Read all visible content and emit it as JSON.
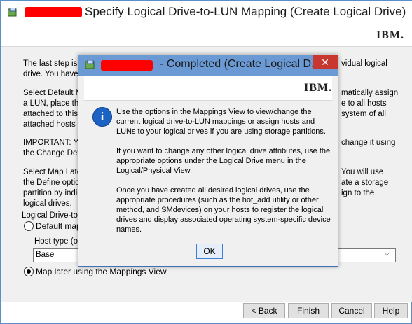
{
  "main_window": {
    "title": "Specify Logical Drive-to-LUN Mapping (Create Logical Drive)",
    "logo": "IBM.",
    "body": {
      "para1_left": "The last step is t",
      "para1_right": "vidual logical",
      "para1_line2": "drive. You have t",
      "para2_left1": "Select Default M",
      "para2_right1": "matically assign",
      "para2_left2": "a LUN, place the",
      "para2_right2": "e to all hosts",
      "para2_left3": "attached to this s",
      "para2_right3": "system of all",
      "para2_left4": "attached hosts m",
      "para3_left1": "IMPORTANT: Yo",
      "para3_right1": "change it using",
      "para3_left2": "the Change Defa",
      "para4_left1": "Select Map Later",
      "para4_right1": "You will use",
      "para4_left2": "the Define option",
      "para4_right2": "ate a storage",
      "para4_left3": "partition by indic",
      "para4_right3": "ign to the",
      "para4_left4": "logical drives.",
      "group_label": "Logical Drive-to-L",
      "radio_default_label": "Default mapp",
      "host_type_label": "Host type (op",
      "host_type_value": "Base",
      "radio_map_later_label": "Map later using the Mappings View"
    },
    "buttons": {
      "back": "< Back",
      "finish": "Finish",
      "cancel": "Cancel",
      "help": "Help"
    }
  },
  "dialog": {
    "title": "- Completed (Create Logical D...",
    "close": "✕",
    "logo": "IBM.",
    "info_icon": "i",
    "para1": "Use the options in the Mappings View to view/change the current logical drive-to-LUN mappings or assign hosts and LUNs to your logical drives if you are using storage partitions.",
    "para2": "If you want to change any other logical drive attributes, use the appropriate options under the Logical Drive menu in the Logical/Physical View.",
    "para3": "Once you have created all desired logical drives, use the appropriate procedures (such as the hot_add utility or other method, and SMdevices) on your hosts to register the logical drives and display associated operating system-specific device names.",
    "ok": "OK"
  }
}
